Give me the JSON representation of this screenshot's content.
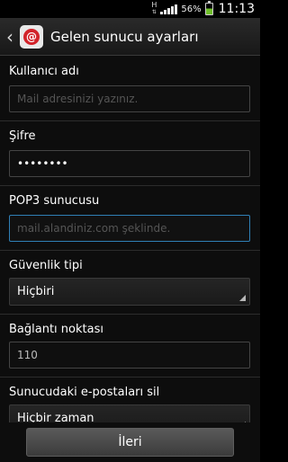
{
  "status_bar": {
    "network": "H",
    "battery_percent": "56%",
    "time": "11:13"
  },
  "action_bar": {
    "title": "Gelen sunucu ayarları",
    "app_icon_glyph": "@"
  },
  "fields": {
    "username": {
      "label": "Kullanıcı adı",
      "placeholder": "Mail adresinizi yazınız.",
      "value": ""
    },
    "password": {
      "label": "Şifre",
      "value": "••••••••"
    },
    "pop3": {
      "label": "POP3 sunucusu",
      "placeholder": "mail.alandiniz.com şeklinde.",
      "value": ""
    },
    "security": {
      "label": "Güvenlik tipi",
      "value": "Hiçbiri"
    },
    "port": {
      "label": "Bağlantı noktası",
      "value": "110"
    },
    "delete_email": {
      "label": "Sunucudaki e-postaları sil",
      "value": "Hiçbir zaman"
    }
  },
  "buttons": {
    "next": "İleri"
  },
  "colors": {
    "accent_focus": "#2f7fb5",
    "app_icon_red": "#d2232a",
    "battery_green": "#6fbf2a"
  }
}
